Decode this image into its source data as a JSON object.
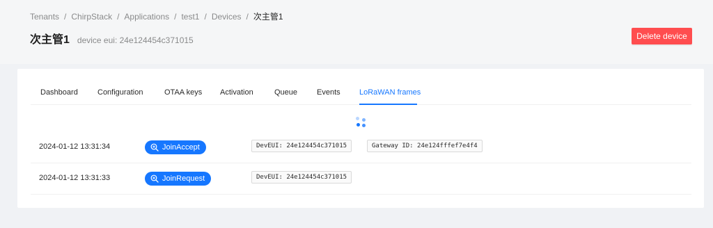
{
  "breadcrumb": {
    "items": [
      "Tenants",
      "ChirpStack",
      "Applications",
      "test1",
      "Devices",
      "次主管1"
    ],
    "separator": "/"
  },
  "header": {
    "title": "次主管1",
    "subtitle": "device eui: 24e124454c371015",
    "delete_label": "Delete device"
  },
  "tabs": {
    "items": [
      "Dashboard",
      "Configuration",
      "OTAA keys",
      "Activation",
      "Queue",
      "Events",
      "LoRaWAN frames"
    ],
    "active": "LoRaWAN frames"
  },
  "frames": [
    {
      "time": "2024-01-12 13:31:34",
      "type": "JoinAccept",
      "dev_eui": "DevEUI: 24e124454c371015",
      "gateway": "Gateway ID: 24e124fffef7e4f4"
    },
    {
      "time": "2024-01-12 13:31:33",
      "type": "JoinRequest",
      "dev_eui": "DevEUI: 24e124454c371015"
    }
  ],
  "colors": {
    "primary": "#1677ff",
    "danger": "#ff4d4f",
    "page_bg": "#f0f2f5"
  },
  "icons": {
    "frame_button_icon": "zoom-in-icon",
    "loading": "loading-spinner-icon"
  }
}
